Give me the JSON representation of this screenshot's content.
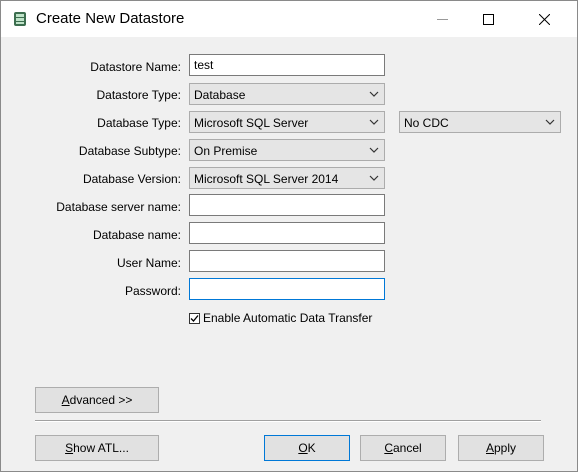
{
  "window": {
    "title": "Create New Datastore"
  },
  "form": {
    "datastore_name": {
      "label": "Datastore Name:",
      "value": "test"
    },
    "datastore_type": {
      "label": "Datastore Type:",
      "value": "Database"
    },
    "database_type": {
      "label": "Database Type:",
      "value": "Microsoft SQL Server",
      "cdc_value": "No CDC"
    },
    "database_subtype": {
      "label": "Database Subtype:",
      "value": "On Premise"
    },
    "database_version": {
      "label": "Database Version:",
      "value": "Microsoft SQL Server 2014"
    },
    "server_name": {
      "label": "Database server name:",
      "value": ""
    },
    "database_name": {
      "label": "Database name:",
      "value": ""
    },
    "user_name": {
      "label": "User Name:",
      "value": ""
    },
    "password": {
      "label": "Password:",
      "value": ""
    },
    "auto_transfer": {
      "label": "Enable Automatic Data Transfer",
      "checked": true
    }
  },
  "buttons": {
    "advanced": {
      "mnemonic": "A",
      "rest": "dvanced >>"
    },
    "show_atl": {
      "mnemonic": "S",
      "rest": "how ATL..."
    },
    "ok": {
      "mnemonic": "O",
      "rest": "K"
    },
    "cancel": {
      "mnemonic": "C",
      "rest": "ancel"
    },
    "apply": {
      "mnemonic": "A",
      "rest": "pply"
    }
  }
}
